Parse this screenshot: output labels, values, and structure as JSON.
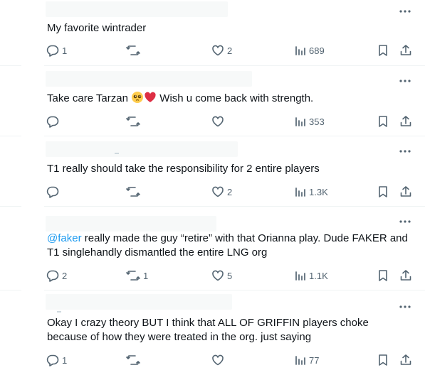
{
  "replies": [
    {
      "text": "My favorite wintrader",
      "stats": {
        "replies": "1",
        "reposts": "",
        "likes": "2",
        "views": "689"
      }
    },
    {
      "text_before": "Take care Tarzan ",
      "text_after": " Wish u come back with strength.",
      "emojis": [
        "pleading-face",
        "red-heart"
      ],
      "stats": {
        "replies": "",
        "reposts": "",
        "likes": "",
        "views": "353"
      }
    },
    {
      "text": "T1 really should take the responsibility for 2 entire players",
      "stats": {
        "replies": "",
        "reposts": "",
        "likes": "2",
        "views": "1.3K"
      }
    },
    {
      "mention": "@faker",
      "text": " really made the guy “retire” with that Orianna play. Dude FAKER and T1 singlehandly dismantled the entire LNG org",
      "stats": {
        "replies": "2",
        "reposts": "1",
        "likes": "5",
        "views": "1.1K"
      }
    },
    {
      "text": "Okay I crazy theory BUT I think that ALL OF GRIFFIN players choke because of how they were treated in the org. just saying",
      "stats": {
        "replies": "1",
        "reposts": "",
        "likes": "",
        "views": "77"
      }
    }
  ],
  "icons": {
    "reply": "speech-bubble-icon",
    "repost": "repost-arrows-icon",
    "like": "heart-outline-icon",
    "views": "bar-chart-icon",
    "bookmark": "bookmark-icon",
    "share": "share-upload-icon",
    "more": "more-dots-icon"
  },
  "colors": {
    "icon": "#536471",
    "border": "#eff3f4",
    "mention": "#1d9bf0",
    "text": "#0f1419"
  }
}
